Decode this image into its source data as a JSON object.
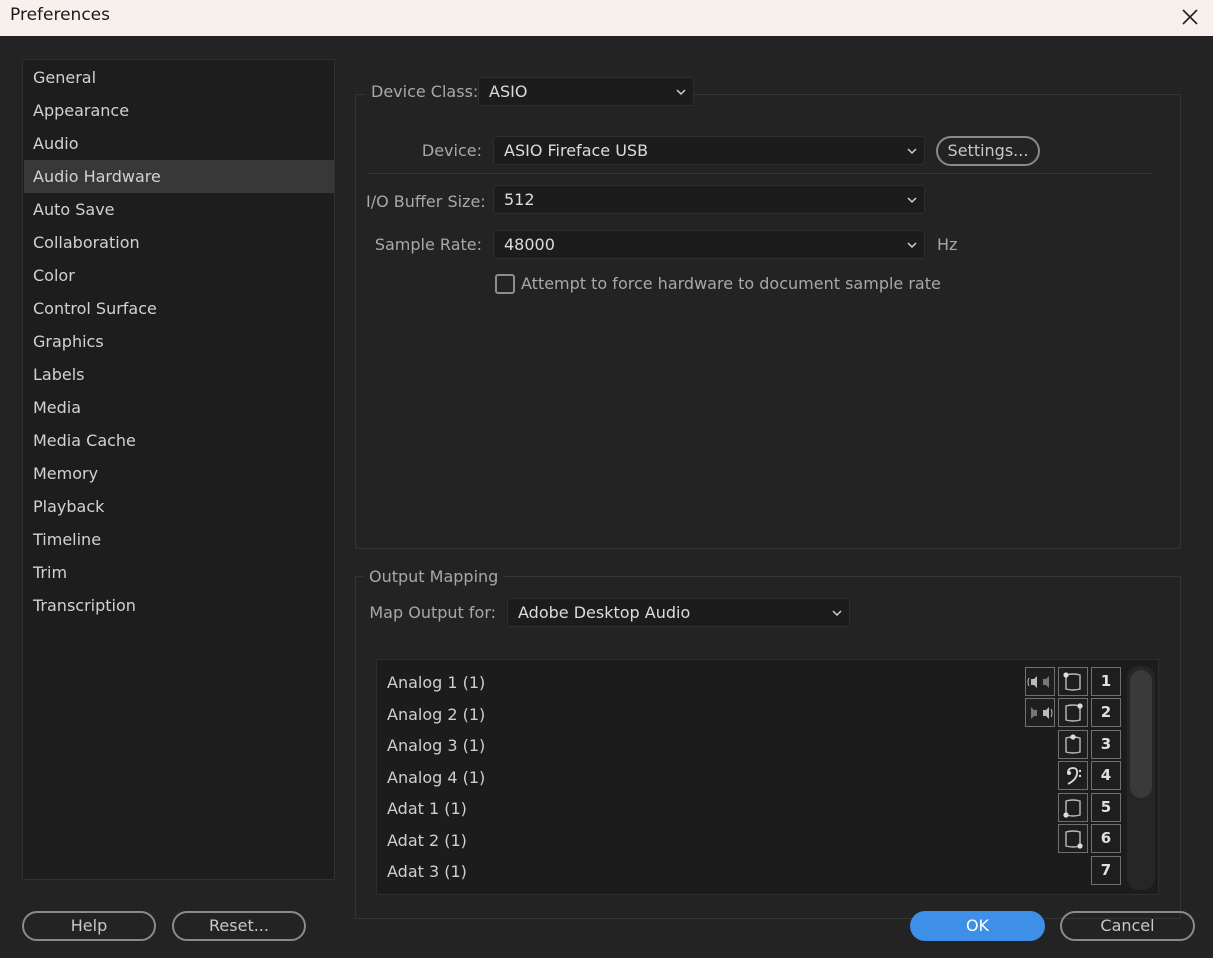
{
  "window": {
    "title": "Preferences"
  },
  "sidebar": {
    "items": [
      {
        "label": "General"
      },
      {
        "label": "Appearance"
      },
      {
        "label": "Audio"
      },
      {
        "label": "Audio Hardware",
        "active": true
      },
      {
        "label": "Auto Save"
      },
      {
        "label": "Collaboration"
      },
      {
        "label": "Color"
      },
      {
        "label": "Control Surface"
      },
      {
        "label": "Graphics"
      },
      {
        "label": "Labels"
      },
      {
        "label": "Media"
      },
      {
        "label": "Media Cache"
      },
      {
        "label": "Memory"
      },
      {
        "label": "Playback"
      },
      {
        "label": "Timeline"
      },
      {
        "label": "Trim"
      },
      {
        "label": "Transcription"
      }
    ]
  },
  "hardware": {
    "device_class_label": "Device Class:",
    "device_class_value": "ASIO",
    "device_label": "Device:",
    "device_value": "ASIO Fireface USB",
    "settings_button": "Settings...",
    "buffer_label": "I/O Buffer Size:",
    "buffer_value": "512",
    "sample_rate_label": "Sample Rate:",
    "sample_rate_value": "48000",
    "sample_rate_unit": "Hz",
    "force_rate_label": "Attempt to force hardware to document sample rate",
    "force_rate_checked": false
  },
  "output_mapping": {
    "legend": "Output Mapping",
    "map_for_label": "Map Output for:",
    "map_for_value": "Adobe Desktop Audio",
    "rows": [
      {
        "label": "Analog 1 (1)",
        "channel": "1",
        "icon": "front-left-speaker-icon"
      },
      {
        "label": "Analog 2 (1)",
        "channel": "2",
        "icon": "front-right-speaker-icon"
      },
      {
        "label": "Analog 3 (1)",
        "channel": "3",
        "icon": "center-speaker-icon"
      },
      {
        "label": "Analog 4 (1)",
        "channel": "4",
        "icon": "lfe-bass-clef-icon"
      },
      {
        "label": "Adat 1 (1)",
        "channel": "5",
        "icon": "surround-left-speaker-icon"
      },
      {
        "label": "Adat 2 (1)",
        "channel": "6",
        "icon": "surround-right-speaker-icon"
      },
      {
        "label": "Adat 3 (1)",
        "channel": "7",
        "icon": ""
      }
    ]
  },
  "footer": {
    "help": "Help",
    "reset": "Reset...",
    "ok": "OK",
    "cancel": "Cancel"
  },
  "colors": {
    "accent": "#3d8fe8",
    "background": "#232323",
    "titlebar": "#f7f0ec"
  }
}
